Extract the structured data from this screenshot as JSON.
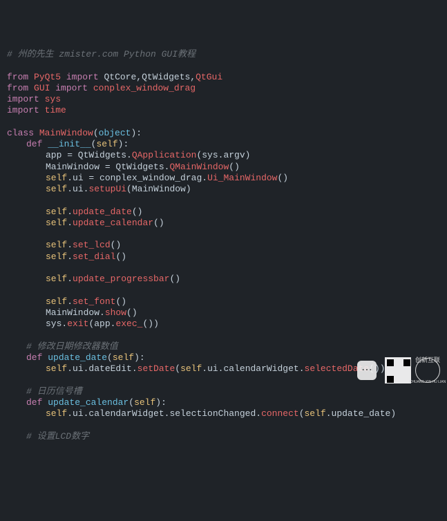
{
  "lines": [
    {
      "cls": "i0",
      "html": [
        {
          "c": "c",
          "t": "# 州的先生 zmister.com Python GUI教程"
        }
      ]
    },
    {
      "cls": "i0",
      "html": []
    },
    {
      "cls": "i0",
      "html": [
        {
          "c": "k",
          "t": "from"
        },
        {
          "c": "w",
          "t": " "
        },
        {
          "c": "m",
          "t": "PyQt5"
        },
        {
          "c": "w",
          "t": " "
        },
        {
          "c": "k",
          "t": "import"
        },
        {
          "c": "w",
          "t": " QtCore,QtWidgets,"
        },
        {
          "c": "m",
          "t": "QtGui"
        }
      ]
    },
    {
      "cls": "i0",
      "html": [
        {
          "c": "k",
          "t": "from"
        },
        {
          "c": "w",
          "t": " "
        },
        {
          "c": "m",
          "t": "GUI"
        },
        {
          "c": "w",
          "t": " "
        },
        {
          "c": "k",
          "t": "import"
        },
        {
          "c": "w",
          "t": " "
        },
        {
          "c": "m",
          "t": "conplex_window_drag"
        }
      ]
    },
    {
      "cls": "i0",
      "html": [
        {
          "c": "k",
          "t": "import"
        },
        {
          "c": "w",
          "t": " "
        },
        {
          "c": "m",
          "t": "sys"
        }
      ]
    },
    {
      "cls": "i0",
      "html": [
        {
          "c": "k",
          "t": "import"
        },
        {
          "c": "w",
          "t": " "
        },
        {
          "c": "m",
          "t": "time"
        }
      ]
    },
    {
      "cls": "i0",
      "html": []
    },
    {
      "cls": "i0",
      "html": [
        {
          "c": "k",
          "t": "class"
        },
        {
          "c": "w",
          "t": " "
        },
        {
          "c": "m",
          "t": "MainWindow"
        },
        {
          "c": "w",
          "t": "("
        },
        {
          "c": "s",
          "t": "object"
        },
        {
          "c": "w",
          "t": "):"
        }
      ]
    },
    {
      "cls": "i1",
      "html": [
        {
          "c": "k",
          "t": "def"
        },
        {
          "c": "w",
          "t": " "
        },
        {
          "c": "s",
          "t": "__init__"
        },
        {
          "c": "w",
          "t": "("
        },
        {
          "c": "o",
          "t": "self"
        },
        {
          "c": "w",
          "t": "):"
        }
      ]
    },
    {
      "cls": "i2",
      "html": [
        {
          "c": "w",
          "t": "app = QtWidgets."
        },
        {
          "c": "mc",
          "t": "QApplication"
        },
        {
          "c": "w",
          "t": "(sys.argv)"
        }
      ]
    },
    {
      "cls": "i2",
      "html": [
        {
          "c": "w",
          "t": "MainWindow = QtWidgets."
        },
        {
          "c": "mc",
          "t": "QMainWindow"
        },
        {
          "c": "w",
          "t": "()"
        }
      ]
    },
    {
      "cls": "i2",
      "html": [
        {
          "c": "o",
          "t": "self"
        },
        {
          "c": "w",
          "t": ".ui = conplex_window_drag."
        },
        {
          "c": "mc",
          "t": "Ui_MainWindow"
        },
        {
          "c": "w",
          "t": "()"
        }
      ]
    },
    {
      "cls": "i2",
      "html": [
        {
          "c": "o",
          "t": "self"
        },
        {
          "c": "w",
          "t": ".ui."
        },
        {
          "c": "mc",
          "t": "setupUi"
        },
        {
          "c": "w",
          "t": "(MainWindow)"
        }
      ]
    },
    {
      "cls": "i2",
      "html": []
    },
    {
      "cls": "i2",
      "html": [
        {
          "c": "o",
          "t": "self"
        },
        {
          "c": "w",
          "t": "."
        },
        {
          "c": "mc",
          "t": "update_date"
        },
        {
          "c": "w",
          "t": "()"
        }
      ]
    },
    {
      "cls": "i2",
      "html": [
        {
          "c": "o",
          "t": "self"
        },
        {
          "c": "w",
          "t": "."
        },
        {
          "c": "mc",
          "t": "update_calendar"
        },
        {
          "c": "w",
          "t": "()"
        }
      ]
    },
    {
      "cls": "i2",
      "html": []
    },
    {
      "cls": "i2",
      "html": [
        {
          "c": "o",
          "t": "self"
        },
        {
          "c": "w",
          "t": "."
        },
        {
          "c": "mc",
          "t": "set_lcd"
        },
        {
          "c": "w",
          "t": "()"
        }
      ]
    },
    {
      "cls": "i2",
      "html": [
        {
          "c": "o",
          "t": "self"
        },
        {
          "c": "w",
          "t": "."
        },
        {
          "c": "mc",
          "t": "set_dial"
        },
        {
          "c": "w",
          "t": "()"
        }
      ]
    },
    {
      "cls": "i2",
      "html": []
    },
    {
      "cls": "i2",
      "html": [
        {
          "c": "o",
          "t": "self"
        },
        {
          "c": "w",
          "t": "."
        },
        {
          "c": "mc",
          "t": "update_progressbar"
        },
        {
          "c": "w",
          "t": "()"
        }
      ]
    },
    {
      "cls": "i2",
      "html": []
    },
    {
      "cls": "i2",
      "html": [
        {
          "c": "o",
          "t": "self"
        },
        {
          "c": "w",
          "t": "."
        },
        {
          "c": "mc",
          "t": "set_font"
        },
        {
          "c": "w",
          "t": "()"
        }
      ]
    },
    {
      "cls": "i2",
      "html": [
        {
          "c": "w",
          "t": "MainWindow."
        },
        {
          "c": "mc",
          "t": "show"
        },
        {
          "c": "w",
          "t": "()"
        }
      ]
    },
    {
      "cls": "i2",
      "html": [
        {
          "c": "w",
          "t": "sys."
        },
        {
          "c": "mc",
          "t": "exit"
        },
        {
          "c": "w",
          "t": "(app."
        },
        {
          "c": "mc",
          "t": "exec_"
        },
        {
          "c": "w",
          "t": "())"
        }
      ]
    },
    {
      "cls": "i0",
      "html": []
    },
    {
      "cls": "i1",
      "html": [
        {
          "c": "c",
          "t": "# 修改日期修改器数值"
        }
      ]
    },
    {
      "cls": "i1",
      "html": [
        {
          "c": "k",
          "t": "def"
        },
        {
          "c": "w",
          "t": " "
        },
        {
          "c": "s",
          "t": "update_date"
        },
        {
          "c": "w",
          "t": "("
        },
        {
          "c": "o",
          "t": "self"
        },
        {
          "c": "w",
          "t": "):"
        }
      ]
    },
    {
      "cls": "i2",
      "html": [
        {
          "c": "o",
          "t": "self"
        },
        {
          "c": "w",
          "t": ".ui.dateEdit."
        },
        {
          "c": "mc",
          "t": "setDate"
        },
        {
          "c": "w",
          "t": "("
        },
        {
          "c": "o",
          "t": "self"
        },
        {
          "c": "w",
          "t": ".ui.calendarWidget."
        },
        {
          "c": "mc",
          "t": "selectedDate"
        },
        {
          "c": "w",
          "t": "())"
        }
      ]
    },
    {
      "cls": "i0",
      "html": []
    },
    {
      "cls": "i1",
      "html": [
        {
          "c": "c",
          "t": "# 日历信号槽"
        }
      ]
    },
    {
      "cls": "i1",
      "html": [
        {
          "c": "k",
          "t": "def"
        },
        {
          "c": "w",
          "t": " "
        },
        {
          "c": "s",
          "t": "update_calendar"
        },
        {
          "c": "w",
          "t": "("
        },
        {
          "c": "o",
          "t": "self"
        },
        {
          "c": "w",
          "t": "):"
        }
      ]
    },
    {
      "cls": "i2",
      "html": [
        {
          "c": "o",
          "t": "self"
        },
        {
          "c": "w",
          "t": ".ui.calendarWidget.selectionChanged."
        },
        {
          "c": "mc",
          "t": "connect"
        },
        {
          "c": "w",
          "t": "("
        },
        {
          "c": "o",
          "t": "self"
        },
        {
          "c": "w",
          "t": ".update_date)"
        }
      ]
    },
    {
      "cls": "i0",
      "html": []
    },
    {
      "cls": "i1",
      "html": [
        {
          "c": "c",
          "t": "# 设置LCD数字"
        }
      ]
    }
  ],
  "watermark": {
    "brand": "创新互联",
    "sub": "CHUANG XIN HU LIAN"
  }
}
